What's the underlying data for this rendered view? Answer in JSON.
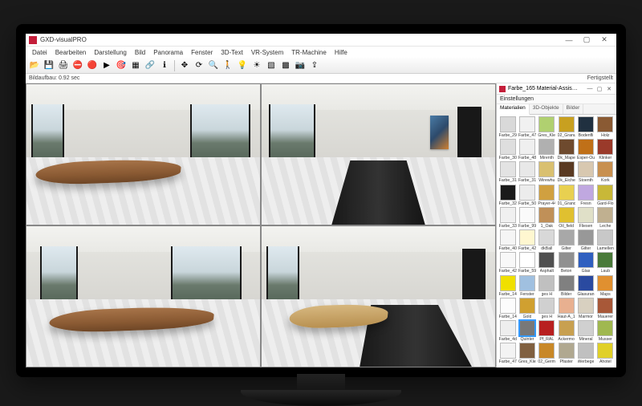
{
  "app_title": "GXD-visualPRO",
  "status": {
    "left": "Bildaufbau: 0.92 sec",
    "right": "Fertigstellt"
  },
  "menu": [
    "Datei",
    "Bearbeiten",
    "Darstellung",
    "Bild",
    "Panorama",
    "Fenster",
    "3D-Text",
    "VR-System",
    "TR-Machine",
    "Hilfe"
  ],
  "toolbar_icons": [
    {
      "n": "open-icon",
      "g": "📂"
    },
    {
      "n": "save-icon",
      "g": "💾"
    },
    {
      "n": "print-icon",
      "g": "🖨"
    },
    {
      "n": "stop-icon",
      "g": "⛔"
    },
    {
      "n": "record-icon",
      "g": "🔴"
    },
    {
      "n": "play-icon",
      "g": "▶"
    },
    {
      "n": "render-icon",
      "g": "🎯"
    },
    {
      "n": "scene-icon",
      "g": "▦"
    },
    {
      "n": "share-icon",
      "g": "🔗"
    },
    {
      "n": "info-icon",
      "g": "ℹ"
    },
    {
      "n": "sep"
    },
    {
      "n": "pan-icon",
      "g": "✥"
    },
    {
      "n": "rotate-icon",
      "g": "⟳"
    },
    {
      "n": "zoom-icon",
      "g": "🔍"
    },
    {
      "n": "walk-icon",
      "g": "🚶"
    },
    {
      "n": "light-icon",
      "g": "💡"
    },
    {
      "n": "sun-icon",
      "g": "☀"
    },
    {
      "n": "material-icon",
      "g": "▧"
    },
    {
      "n": "texture-icon",
      "g": "▩"
    },
    {
      "n": "camera-icon",
      "g": "📷"
    },
    {
      "n": "export-icon",
      "g": "⇪"
    }
  ],
  "sidepanel": {
    "title": "Farbe_165 Material-Assis…",
    "subtitle": "Einstellungen",
    "tabs": [
      "Materialien",
      "3D-Objekte",
      "Bilder"
    ],
    "active_tab": 0,
    "selected": 55
  },
  "materials": [
    {
      "l": "Farbe_29",
      "c": "#d9d9d9"
    },
    {
      "l": "Farbe_47",
      "c": "#f1f1f1"
    },
    {
      "l": "Gres_Kles",
      "c": "#b0d070"
    },
    {
      "l": "02_Granu",
      "c": "#c8a020"
    },
    {
      "l": "Bodenfli",
      "c": "#203040"
    },
    {
      "l": "Holz",
      "c": "#8a5a33"
    },
    {
      "l": "Farbe_30",
      "c": "#dedede"
    },
    {
      "l": "Farbe_48",
      "c": "#efefef"
    },
    {
      "l": "Mirenth",
      "c": "#b0b0b0"
    },
    {
      "l": "Dk_Mape",
      "c": "#6e4a2e"
    },
    {
      "l": "Esper-Ou",
      "c": "#c07018"
    },
    {
      "l": "Klinker",
      "c": "#9a3a2a"
    },
    {
      "l": "Farbe_31",
      "c": "#e3e3e3"
    },
    {
      "l": "Farbe_31",
      "c": "#e8e8e8"
    },
    {
      "l": "Wirewhu",
      "c": "#d9c070"
    },
    {
      "l": "Dk_Eiche",
      "c": "#5a3a22"
    },
    {
      "l": "Stoenth",
      "c": "#d8c8b0"
    },
    {
      "l": "Kork",
      "c": "#c89050"
    },
    {
      "l": "Farbe_32",
      "c": "#1a1a1a"
    },
    {
      "l": "Farbe_50",
      "c": "#ececec"
    },
    {
      "l": "Prayer-44",
      "c": "#d0a040"
    },
    {
      "l": "01_Grand",
      "c": "#e8d050"
    },
    {
      "l": "Fresn",
      "c": "#c0a8e0"
    },
    {
      "l": "Gard-Flo",
      "c": "#c8b838"
    },
    {
      "l": "Farbe_339",
      "c": "#f0f0f0"
    },
    {
      "l": "Farbe_99",
      "c": "#fafafa"
    },
    {
      "l": "1_Oak",
      "c": "#c09058"
    },
    {
      "l": "Oil_field",
      "c": "#e0c030"
    },
    {
      "l": "Fliesen",
      "c": "#e0e0c8"
    },
    {
      "l": "Leche",
      "c": "#c0b090"
    },
    {
      "l": "Farbe_40",
      "c": "#f5f5f5"
    },
    {
      "l": "Farbe_42",
      "c": "#fff7d0"
    },
    {
      "l": "dkBall",
      "c": "#d8d8d8"
    },
    {
      "l": "Gilter",
      "c": "#a8a8a8"
    },
    {
      "l": "Gilter",
      "c": "#989898"
    },
    {
      "l": "Lamellen",
      "c": "#c8c8c8"
    },
    {
      "l": "Farbe_42",
      "c": "#f8f8f8"
    },
    {
      "l": "Farbe_59",
      "c": "#ffffff"
    },
    {
      "l": "Asphalt",
      "c": "#505050"
    },
    {
      "l": "Beton",
      "c": "#909090"
    },
    {
      "l": "Glas",
      "c": "#3060c0"
    },
    {
      "l": "Laub",
      "c": "#4a7a3a"
    },
    {
      "l": "Farbe_144",
      "c": "#f0e000"
    },
    {
      "l": "Fenster",
      "c": "#a0c0e0"
    },
    {
      "l": "ges H",
      "c": "#c0c0c0"
    },
    {
      "l": "Bilder",
      "c": "#808080"
    },
    {
      "l": "Glasuran",
      "c": "#2a4aa0"
    },
    {
      "l": "Maps",
      "c": "#e09030"
    },
    {
      "l": "Farbe_144",
      "c": "#fcfcfc"
    },
    {
      "l": "Gold",
      "c": "#d0a030"
    },
    {
      "l": "ges H",
      "c": "#d0d0d0"
    },
    {
      "l": "Haut-A_1",
      "c": "#e8b090"
    },
    {
      "l": "Marmor",
      "c": "#d8d0c0"
    },
    {
      "l": "Mauerer",
      "c": "#a85838"
    },
    {
      "l": "Farbe_4d",
      "c": "#eeeeee"
    },
    {
      "l": "Quinter",
      "c": "#787878"
    },
    {
      "l": "Pf_RAL",
      "c": "#b82020"
    },
    {
      "l": "Ackermo",
      "c": "#c8a050"
    },
    {
      "l": "Mineral",
      "c": "#d0d0d0"
    },
    {
      "l": "Musser",
      "c": "#a0b850"
    },
    {
      "l": "Farbe_47",
      "c": "#f3f3f3"
    },
    {
      "l": "Gres_Kles",
      "c": "#806040"
    },
    {
      "l": "02_Germa",
      "c": "#c88828"
    },
    {
      "l": "Pfaster",
      "c": "#b0a890"
    },
    {
      "l": "Werbege",
      "c": "#c0c0c0"
    },
    {
      "l": "Ahotel",
      "c": "#e0d028"
    }
  ]
}
